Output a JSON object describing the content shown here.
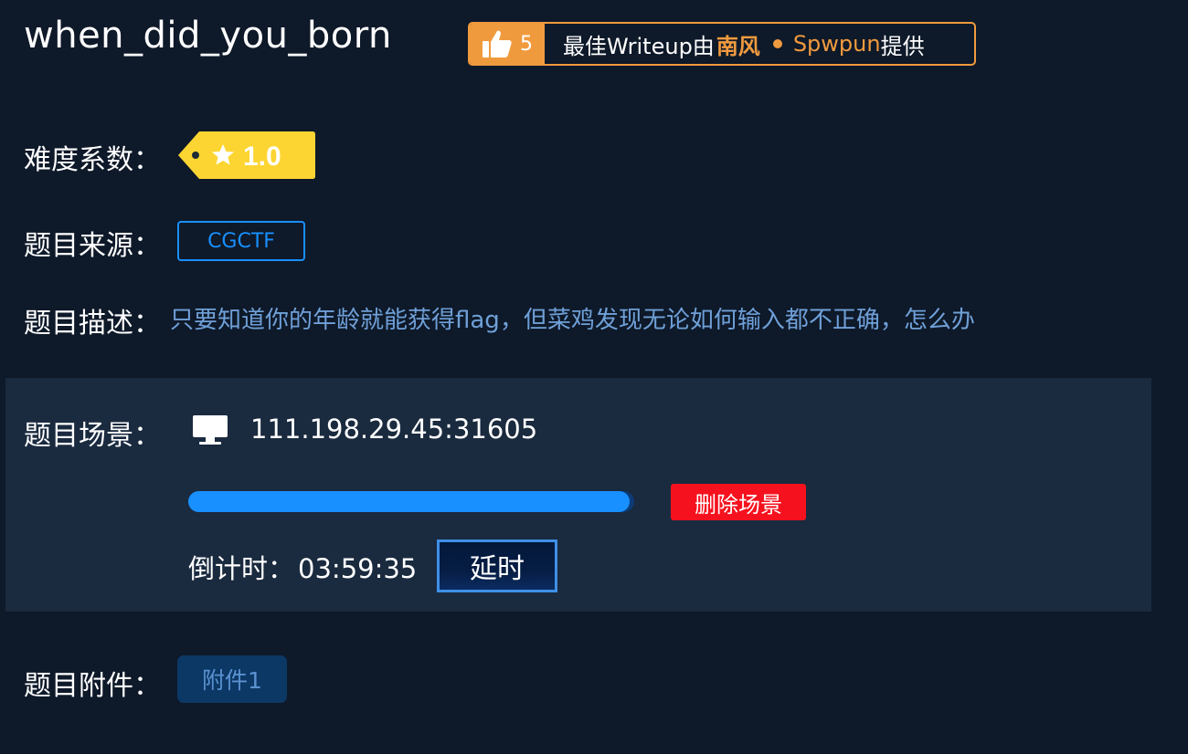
{
  "challenge": {
    "title": "when_did_you_born"
  },
  "writeup_badge": {
    "likes": "5",
    "prefix": "最佳Writeup由",
    "author": "南风",
    "user": "Spwpun",
    "suffix": "提供",
    "accent_color": "#f09a3e"
  },
  "difficulty": {
    "label": "难度系数：",
    "value": "1.0",
    "tag_color": "#fcd532",
    "icon": "star-icon"
  },
  "source": {
    "label": "题目来源：",
    "value": "CGCTF"
  },
  "description": {
    "label": "题目描述：",
    "text": "只要知道你的年龄就能获得flag，但菜鸡发现无论如何输入都不正确，怎么办"
  },
  "scene": {
    "label": "题目场景：",
    "icon": "monitor-icon",
    "address": "111.198.29.45:31605",
    "progress": 0.99,
    "delete_label": "删除场景",
    "countdown_label": "倒计时：",
    "countdown_value": "03:59:35",
    "extend_label": "延时"
  },
  "attachments": {
    "label": "题目附件：",
    "items": [
      {
        "label": "附件1"
      }
    ]
  }
}
